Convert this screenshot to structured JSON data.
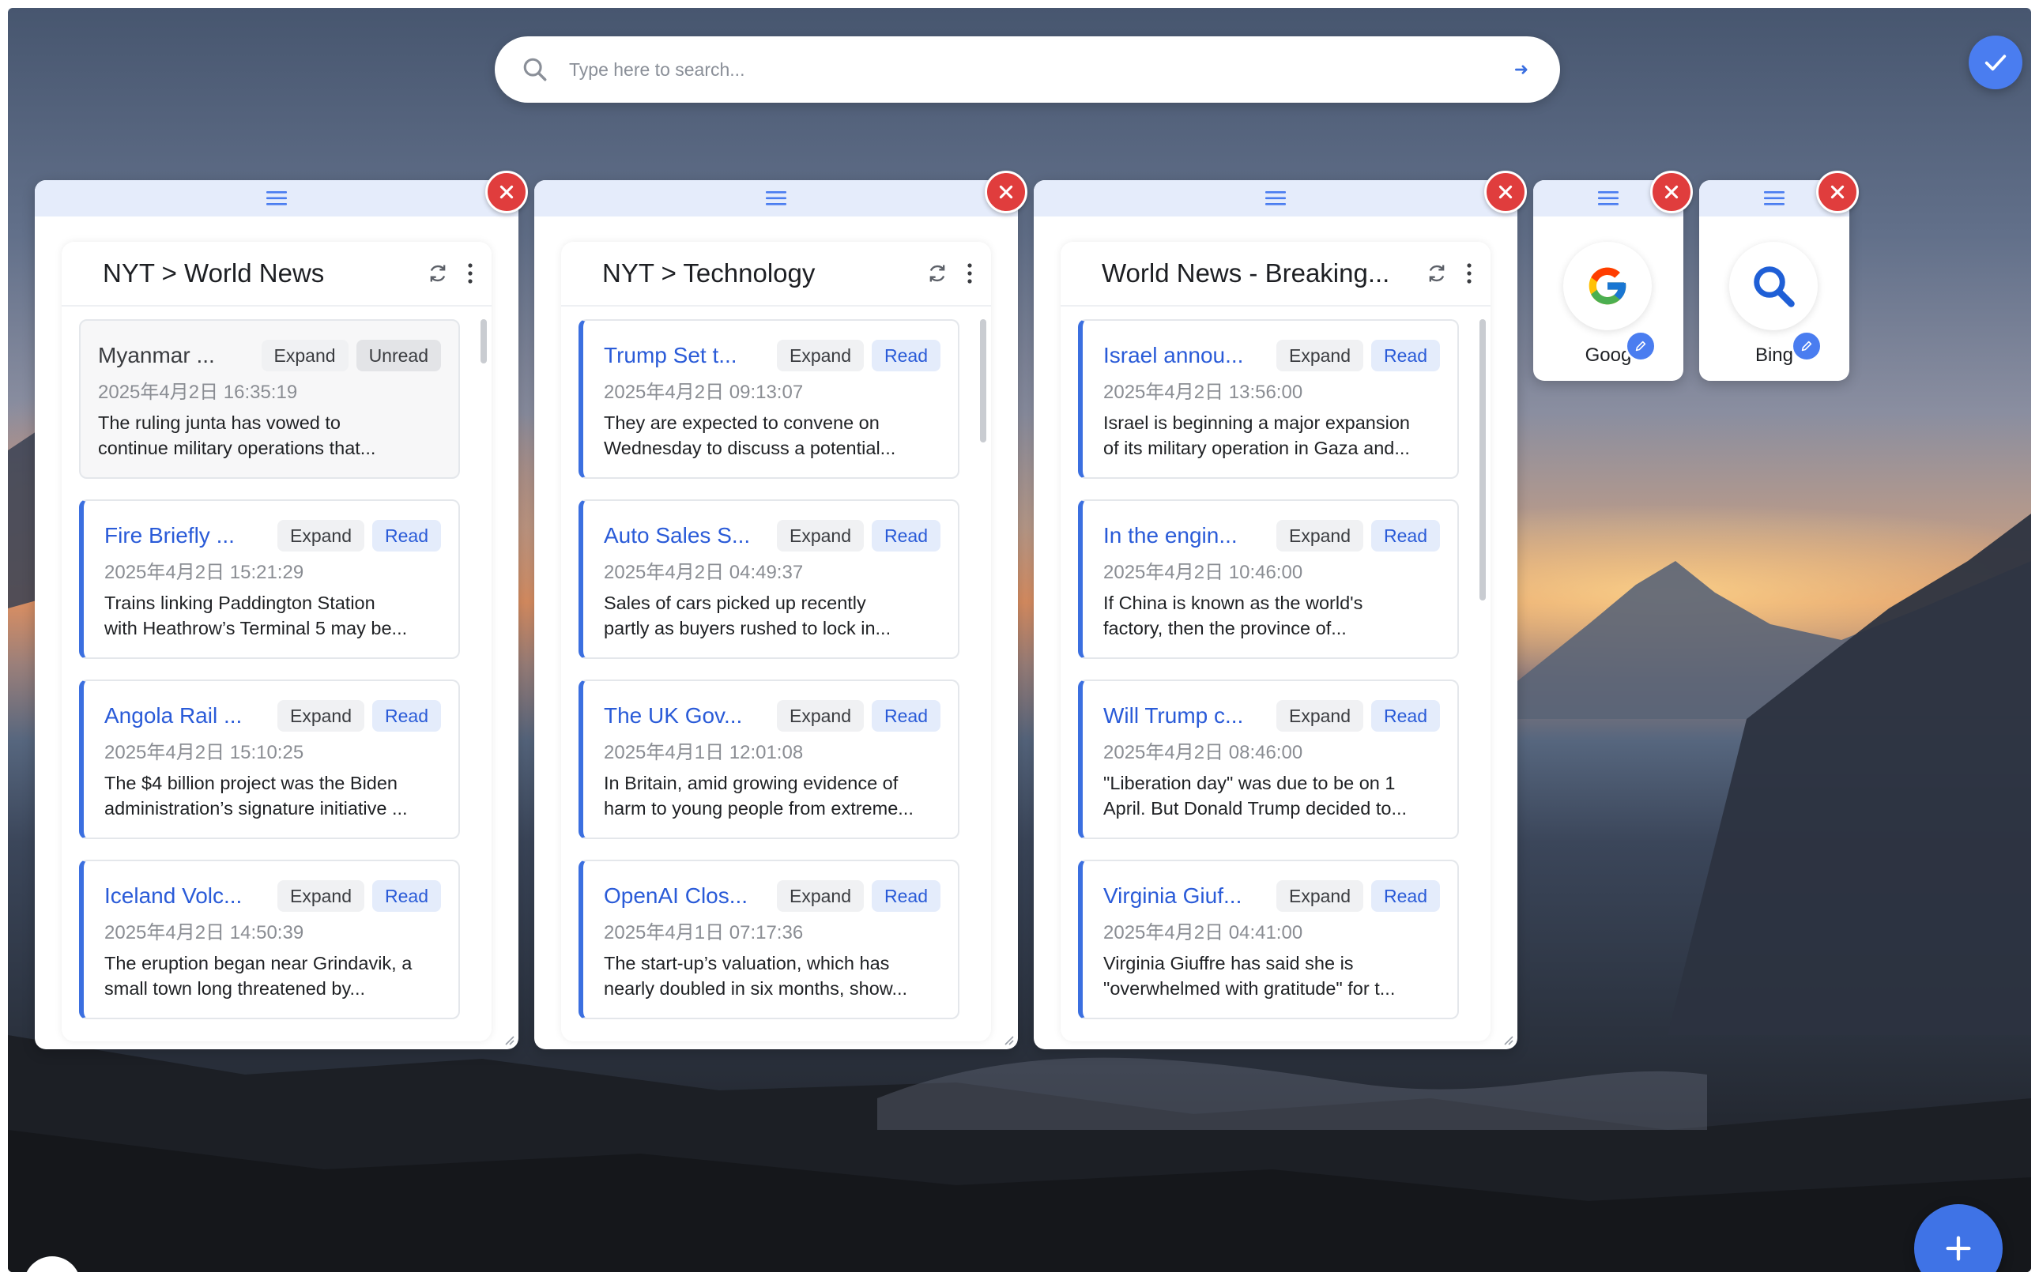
{
  "search": {
    "placeholder": "Type here to search...",
    "submit_icon": "arrow-right-icon"
  },
  "controls": {
    "confirm_icon": "check-icon",
    "add_icon": "plus-icon"
  },
  "colors": {
    "accent": "#3b6fe0",
    "close": "#e03d3d",
    "read_pill": "#e4ecfb"
  },
  "feeds": [
    {
      "title": "NYT > World News",
      "items": [
        {
          "title": "Myanmar ...",
          "status": "Unread",
          "expand": "Expand",
          "date": "2025年4月2日 16:35:19",
          "desc1": "The ruling junta has vowed to",
          "desc2": "continue military operations that..."
        },
        {
          "title": "Fire Briefly ...",
          "status": "Read",
          "expand": "Expand",
          "date": "2025年4月2日 15:21:29",
          "desc1": "Trains linking Paddington Station",
          "desc2": "with Heathrow’s Terminal 5 may be..."
        },
        {
          "title": "Angola Rail ...",
          "status": "Read",
          "expand": "Expand",
          "date": "2025年4月2日 15:10:25",
          "desc1": "The $4 billion project was the Biden",
          "desc2": "administration’s signature initiative ..."
        },
        {
          "title": "Iceland Volc...",
          "status": "Read",
          "expand": "Expand",
          "date": "2025年4月2日 14:50:39",
          "desc1": "The eruption began near Grindavik, a",
          "desc2": "small town long threatened by..."
        }
      ]
    },
    {
      "title": "NYT > Technology",
      "items": [
        {
          "title": "Trump Set t...",
          "status": "Read",
          "expand": "Expand",
          "date": "2025年4月2日 09:13:07",
          "desc1": "They are expected to convene on",
          "desc2": "Wednesday to discuss a potential..."
        },
        {
          "title": "Auto Sales S...",
          "status": "Read",
          "expand": "Expand",
          "date": "2025年4月2日 04:49:37",
          "desc1": "Sales of cars picked up recently",
          "desc2": "partly as buyers rushed to lock in..."
        },
        {
          "title": "The UK Gov...",
          "status": "Read",
          "expand": "Expand",
          "date": "2025年4月1日 12:01:08",
          "desc1": "In Britain, amid growing evidence of",
          "desc2": "harm to young people from extreme..."
        },
        {
          "title": "OpenAI Clos...",
          "status": "Read",
          "expand": "Expand",
          "date": "2025年4月1日 07:17:36",
          "desc1": "The start-up’s valuation, which has",
          "desc2": "nearly doubled in six months, show..."
        }
      ]
    },
    {
      "title": "World News - Breaking...",
      "items": [
        {
          "title": "Israel annou...",
          "status": "Read",
          "expand": "Expand",
          "date": "2025年4月2日 13:56:00",
          "desc1": "Israel is beginning a major expansion",
          "desc2": "of its military operation in Gaza and..."
        },
        {
          "title": "In the engin...",
          "status": "Read",
          "expand": "Expand",
          "date": "2025年4月2日 10:46:00",
          "desc1": "If China is known as the world's",
          "desc2": "factory, then the province of..."
        },
        {
          "title": "Will Trump c...",
          "status": "Read",
          "expand": "Expand",
          "date": "2025年4月2日 08:46:00",
          "desc1": "\"Liberation day\" was due to be on 1",
          "desc2": "April. But Donald Trump decided to..."
        },
        {
          "title": "Virginia Giuf...",
          "status": "Read",
          "expand": "Expand",
          "date": "2025年4月2日 04:41:00",
          "desc1": "Virginia Giuffre has said she is",
          "desc2": "\"overwhelmed with gratitude\" for t..."
        }
      ]
    }
  ],
  "shortcuts": [
    {
      "label": "Goog",
      "icon": "google-icon"
    },
    {
      "label": "Bing",
      "icon": "bing-search-icon"
    }
  ]
}
